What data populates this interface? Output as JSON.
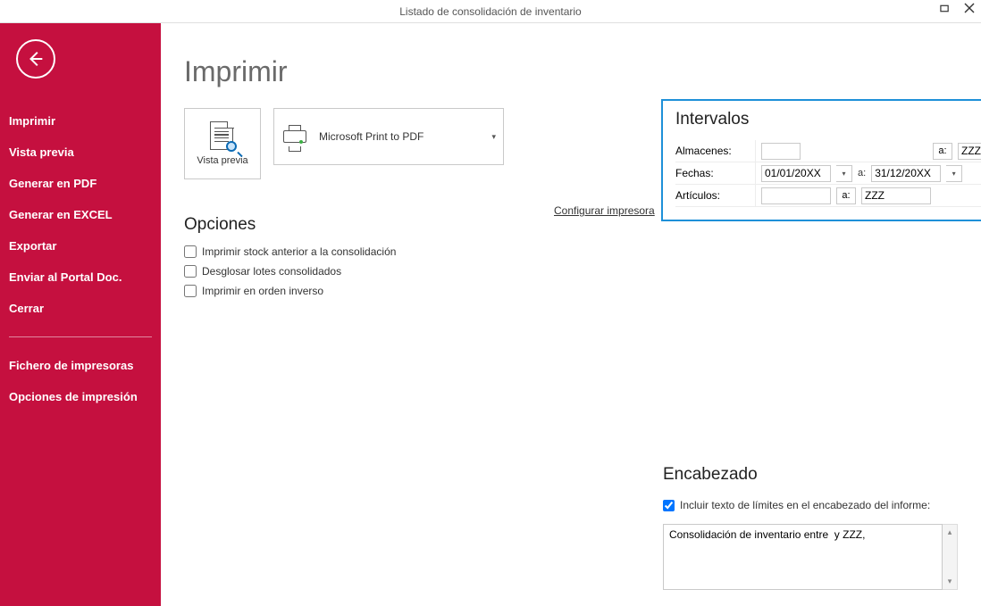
{
  "titlebar": {
    "title": "Listado de consolidación de inventario"
  },
  "sidebar": {
    "items": [
      "Imprimir",
      "Vista previa",
      "Generar en PDF",
      "Generar en EXCEL",
      "Exportar",
      "Enviar al Portal Doc.",
      "Cerrar"
    ],
    "secondary": [
      "Fichero de impresoras",
      "Opciones de impresión"
    ]
  },
  "page": {
    "title": "Imprimir"
  },
  "preview_tile": {
    "label": "Vista previa"
  },
  "printer": {
    "name": "Microsoft Print to PDF"
  },
  "config_link": "Configurar impresora",
  "intervals": {
    "title": "Intervalos",
    "labels": {
      "almacenes": "Almacenes:",
      "fechas": "Fechas:",
      "articulos": "Artículos:",
      "a": "a:"
    },
    "almacenes_from": "",
    "almacenes_to": "ZZZ",
    "fecha_from": "01/01/20XX",
    "fecha_to": "31/12/20XX",
    "articulos_from": "",
    "articulos_to": "ZZZ"
  },
  "opciones": {
    "title": "Opciones",
    "items": [
      {
        "label": "Imprimir stock anterior a la consolidación",
        "checked": false
      },
      {
        "label": "Desglosar lotes consolidados",
        "checked": false
      },
      {
        "label": "Imprimir en orden inverso",
        "checked": false
      }
    ]
  },
  "encabezado": {
    "title": "Encabezado",
    "check_label": "Incluir texto de límites en el encabezado del informe:",
    "check_checked": true,
    "text": "Consolidación de inventario entre  y ZZZ,"
  }
}
